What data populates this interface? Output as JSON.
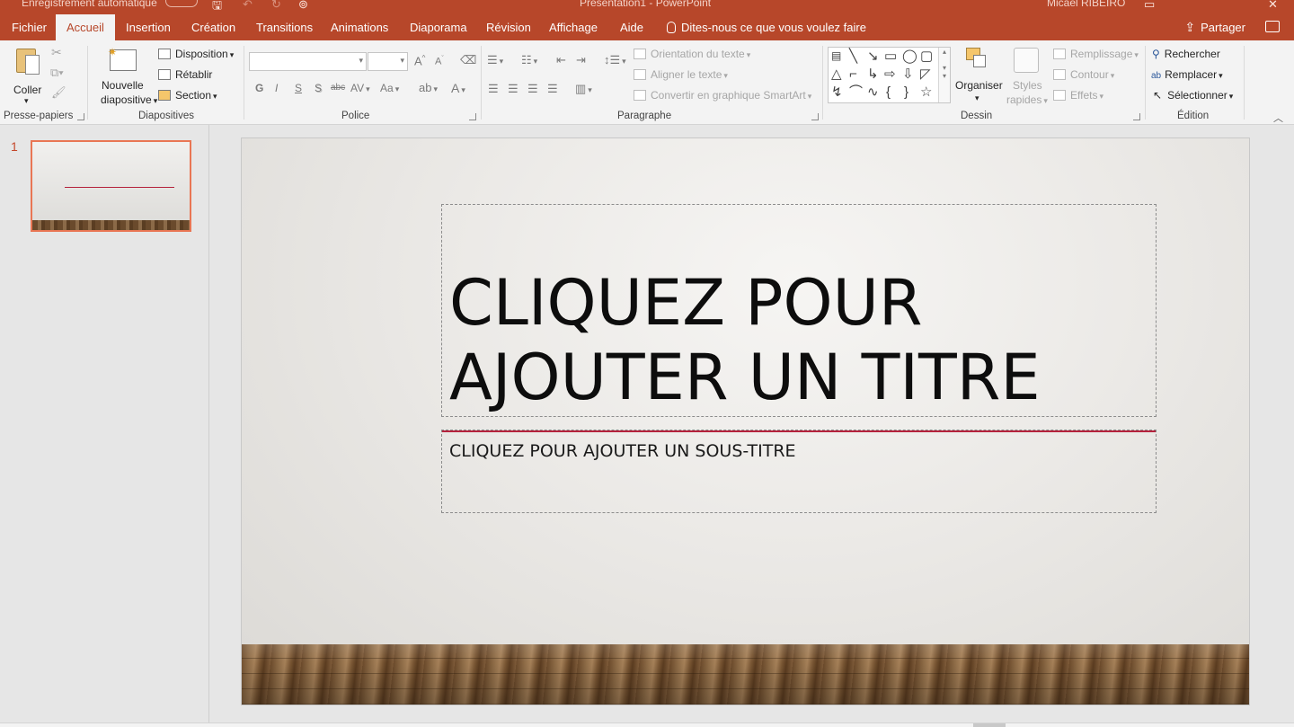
{
  "titlebar": {
    "autosave_label": "Enregistrement automatique",
    "doc_title": "Présentation1 - PowerPoint",
    "user": "Micael RIBEIRO"
  },
  "tabs": [
    {
      "label": "Fichier"
    },
    {
      "label": "Accueil",
      "active": true
    },
    {
      "label": "Insertion"
    },
    {
      "label": "Création"
    },
    {
      "label": "Transitions"
    },
    {
      "label": "Animations"
    },
    {
      "label": "Diaporama"
    },
    {
      "label": "Révision"
    },
    {
      "label": "Affichage"
    },
    {
      "label": "Aide"
    }
  ],
  "tell_me": "Dites-nous ce que vous voulez faire",
  "share_label": "Partager",
  "ribbon": {
    "clipboard": {
      "paste": "Coller",
      "group": "Presse-papiers"
    },
    "slides": {
      "new_slide_1": "Nouvelle",
      "new_slide_2": "diapositive",
      "layout": "Disposition",
      "reset": "Rétablir",
      "section": "Section",
      "group": "Diapositives"
    },
    "font": {
      "group": "Police",
      "bold": "G",
      "italic": "I",
      "underline": "S",
      "shadow": "S",
      "strike": "abc",
      "spacing": "AV",
      "case": "Aa",
      "color": "A"
    },
    "paragraph": {
      "group": "Paragraphe",
      "text_direction": "Orientation du texte",
      "align_text": "Aligner le texte",
      "smartart": "Convertir en graphique SmartArt"
    },
    "drawing": {
      "group": "Dessin",
      "arrange": "Organiser",
      "quick_styles_1": "Styles",
      "quick_styles_2": "rapides",
      "fill": "Remplissage",
      "outline": "Contour",
      "effects": "Effets"
    },
    "editing": {
      "group": "Édition",
      "find": "Rechercher",
      "replace": "Remplacer",
      "select": "Sélectionner"
    }
  },
  "thumbnails": [
    {
      "number": "1"
    }
  ],
  "slide": {
    "title": "CLIQUEZ POUR AJOUTER UN TITRE",
    "subtitle": "CLIQUEZ POUR AJOUTER UN SOUS-TITRE"
  },
  "colors": {
    "accent": "#b7472a",
    "title_line": "#b5223c",
    "thumb_border": "#e97654"
  }
}
